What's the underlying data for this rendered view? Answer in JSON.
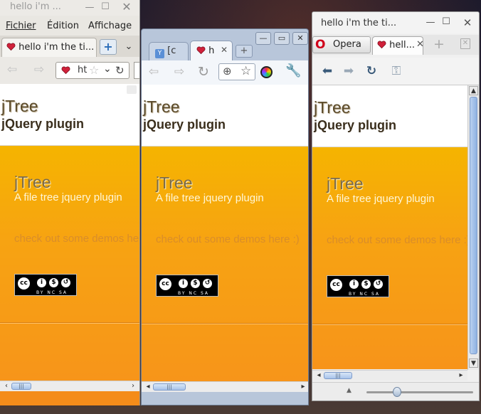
{
  "page": {
    "title_1": "jTree",
    "title_2": "jQuery plugin",
    "hero_title": "jTree",
    "hero_sub": "A file tree jquery plugin",
    "demos_link": "check out some demos here :)",
    "license_terms": "BY NC SA"
  },
  "firefox": {
    "title": "hello i'm ...",
    "menu": [
      "Fichier",
      "Édition",
      "Affichage"
    ],
    "tab_label": "hello i'm the ti...",
    "url_text": "ht"
  },
  "chrome": {
    "tab1_label": "[c",
    "tab2_label": "h"
  },
  "opera": {
    "title": "hello i'm the ti...",
    "opera_button": "Opera",
    "tab_label": "hell..."
  },
  "colors": {
    "page_orange_top": "#f5b400",
    "page_orange_bottom": "#f7941a",
    "firefox_frame": "#e9e7e2",
    "chrome_frame": "#b8c6da",
    "opera_frame": "#f0f0f0"
  },
  "icons": [
    "heart-favicon-icon",
    "back-icon",
    "forward-icon",
    "reload-icon",
    "star-icon",
    "wrench-icon",
    "globe-icon",
    "key-icon",
    "new-tab-icon",
    "close-icon",
    "minimize-icon",
    "maximize-icon",
    "trash-icon"
  ]
}
